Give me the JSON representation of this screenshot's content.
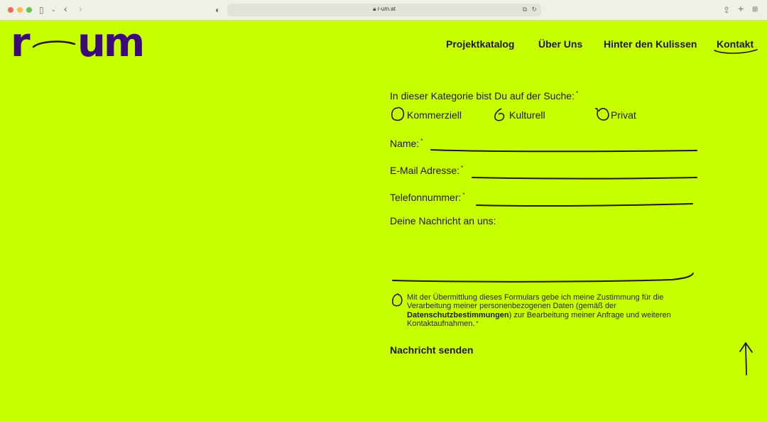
{
  "browser": {
    "url": "r-um.at"
  },
  "site": {
    "logo_text": "r—um",
    "brand_color": "#3b0a78",
    "background_color": "#c8ff00"
  },
  "nav": {
    "items": [
      {
        "label": "Projektkatalog"
      },
      {
        "label": "Über Uns"
      },
      {
        "label": "Hinter den Kulissen"
      },
      {
        "label": "Kontakt"
      }
    ]
  },
  "form": {
    "category_label": "In dieser Kategorie bist Du auf der Suche:",
    "required_mark": "*",
    "options": [
      {
        "label": "Kommerziell"
      },
      {
        "label": "Kulturell"
      },
      {
        "label": "Privat"
      }
    ],
    "name_label": "Name:",
    "email_label": "E-Mail Adresse:",
    "phone_label": "Telefonnummer:",
    "message_label": "Deine Nachricht an uns:",
    "consent_before": "Mit der Übermittlung dieses Formulars gebe ich meine Zustimmung für die Verarbeitung meiner personenbezogenen Daten (gemäß der ",
    "consent_link": "Datenschutzbestimmungen",
    "consent_after": ") zur Bearbeitung meiner Anfrage und weiteren Kontaktaufnahmen.",
    "submit_label": "Nachricht senden"
  }
}
